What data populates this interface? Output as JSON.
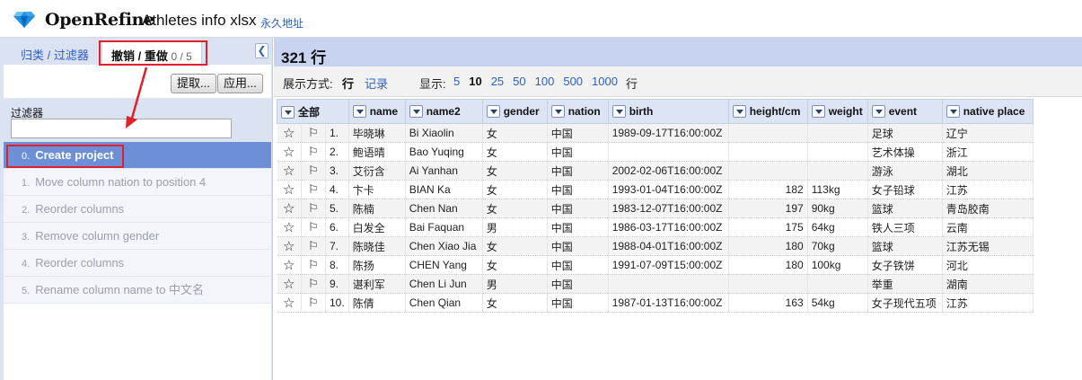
{
  "header": {
    "brand": "OpenRefine",
    "project_name": "Athletes info xlsx",
    "permalink": "永久地址",
    "logo_icon": "diamond-icon"
  },
  "left_panel": {
    "tabs": {
      "facets": "归类 / 过滤器",
      "history": "撤销 / 重做",
      "history_count": "0 / 5"
    },
    "collapse_icon": "chevron-left-icon",
    "extract_label": "提取...",
    "apply_label": "应用...",
    "filter_label": "过滤器",
    "filter_value": "",
    "history": [
      {
        "num": "0.",
        "label": "Create project",
        "current": true
      },
      {
        "num": "1.",
        "label": "Move column nation to position 4",
        "current": false
      },
      {
        "num": "2.",
        "label": "Reorder columns",
        "current": false
      },
      {
        "num": "3.",
        "label": "Remove column gender",
        "current": false
      },
      {
        "num": "4.",
        "label": "Reorder columns",
        "current": false
      },
      {
        "num": "5.",
        "label": "Rename column name to 中文名",
        "current": false
      }
    ]
  },
  "right_panel": {
    "row_count": "321 行",
    "view": {
      "show_as_label": "展示方式:",
      "rows_option": "行",
      "records_option": "记录",
      "display_label": "显示:",
      "page_sizes": [
        "5",
        "10",
        "25",
        "50",
        "100",
        "500",
        "1000"
      ],
      "selected_page_size": "10",
      "unit": "行"
    },
    "columns": [
      "全部",
      "name",
      "name2",
      "gender",
      "nation",
      "birth",
      "height/cm",
      "weight",
      "event",
      "native place"
    ],
    "rows": [
      {
        "idx": "1.",
        "name": "毕晓琳",
        "name2": "Bi Xiaolin",
        "gender": "女",
        "nation": "中国",
        "birth": "1989-09-17T16:00:00Z",
        "height": "",
        "weight": "",
        "event": "足球",
        "native": "辽宁"
      },
      {
        "idx": "2.",
        "name": "鲍语晴",
        "name2": "Bao Yuqing",
        "gender": "女",
        "nation": "中国",
        "birth": "",
        "height": "",
        "weight": "",
        "event": "艺术体操",
        "native": "浙江"
      },
      {
        "idx": "3.",
        "name": "艾衍含",
        "name2": "Ai Yanhan",
        "gender": "女",
        "nation": "中国",
        "birth": "2002-02-06T16:00:00Z",
        "height": "",
        "weight": "",
        "event": "游泳",
        "native": "湖北"
      },
      {
        "idx": "4.",
        "name": "卞卡",
        "name2": "BIAN Ka",
        "gender": "女",
        "nation": "中国",
        "birth": "1993-01-04T16:00:00Z",
        "height": "182",
        "weight": "113kg",
        "event": "女子铅球",
        "native": "江苏"
      },
      {
        "idx": "5.",
        "name": "陈楠",
        "name2": "Chen Nan",
        "gender": "女",
        "nation": "中国",
        "birth": "1983-12-07T16:00:00Z",
        "height": "197",
        "weight": "90kg",
        "event": "篮球",
        "native": "青岛胶南"
      },
      {
        "idx": "6.",
        "name": "白发全",
        "name2": "Bai Faquan",
        "gender": "男",
        "nation": "中国",
        "birth": "1986-03-17T16:00:00Z",
        "height": "175",
        "weight": "64kg",
        "event": "铁人三项",
        "native": "云南"
      },
      {
        "idx": "7.",
        "name": "陈晓佳",
        "name2": "Chen Xiao Jia",
        "gender": "女",
        "nation": "中国",
        "birth": "1988-04-01T16:00:00Z",
        "height": "180",
        "weight": "70kg",
        "event": "篮球",
        "native": "江苏无锡"
      },
      {
        "idx": "8.",
        "name": "陈扬",
        "name2": "CHEN Yang",
        "gender": "女",
        "nation": "中国",
        "birth": "1991-07-09T15:00:00Z",
        "height": "180",
        "weight": "100kg",
        "event": "女子铁饼",
        "native": "河北"
      },
      {
        "idx": "9.",
        "name": "谌利军",
        "name2": "Chen Li Jun",
        "gender": "男",
        "nation": "中国",
        "birth": "",
        "height": "",
        "weight": "",
        "event": "举重",
        "native": "湖南"
      },
      {
        "idx": "10.",
        "name": "陈倩",
        "name2": "Chen Qian",
        "gender": "女",
        "nation": "中国",
        "birth": "1987-01-13T16:00:00Z",
        "height": "163",
        "weight": "54kg",
        "event": "女子现代五项",
        "native": "江苏"
      }
    ]
  },
  "colors": {
    "annotation_red": "#e0202a",
    "current_history_bg": "#6d8fd8",
    "link_blue": "#2b5ec7",
    "date_green": "#1a7f1a"
  }
}
